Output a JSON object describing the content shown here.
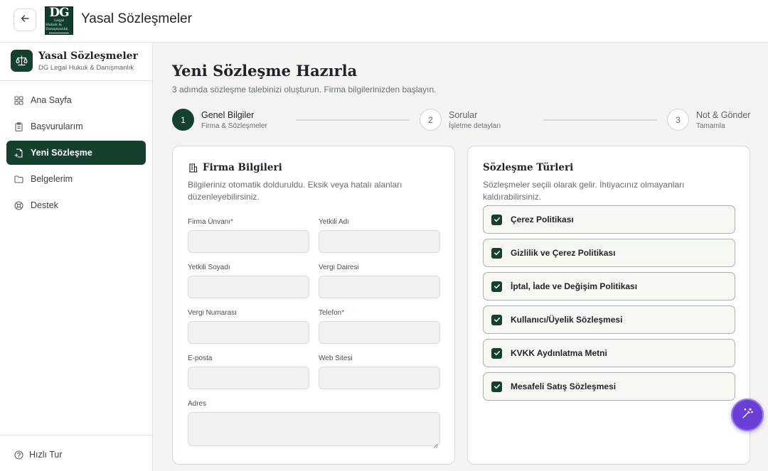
{
  "header": {
    "title": "Yasal Sözleşmeler",
    "back_icon": "arrow-left-icon",
    "logo": {
      "mark": "DG",
      "line": "Legal",
      "sub": "Hukuk & Danışmanlık"
    }
  },
  "sidebar": {
    "brand_name": "Yasal Sözleşmeler",
    "brand_sub": "DG Legal Hukuk & Danışmanlık",
    "brand_icon": "scale-icon",
    "items": [
      {
        "label": "Ana Sayfa",
        "icon": "grid-icon",
        "active": false
      },
      {
        "label": "Başvurularım",
        "icon": "clipboard-icon",
        "active": false
      },
      {
        "label": "Yeni Sözleşme",
        "icon": "file-plus-icon",
        "active": true
      },
      {
        "label": "Belgelerim",
        "icon": "folder-icon",
        "active": false
      },
      {
        "label": "Destek",
        "icon": "lifebuoy-icon",
        "active": false
      }
    ],
    "help_label": "Hızlı Tur",
    "help_icon": "question-circle-icon"
  },
  "page": {
    "title": "Yeni Sözleşme Hazırla",
    "subtitle": "3 adımda sözleşme talebinizi oluşturun. Firma bilgilerinizden başlayın."
  },
  "stepper": [
    {
      "number": "1",
      "label": "Genel Bilgiler",
      "sub": "Firma & Sözleşmeler",
      "state": "active"
    },
    {
      "number": "2",
      "label": "Sorular",
      "sub": "İşletme detayları",
      "state": "todo"
    },
    {
      "number": "3",
      "label": "Not & Gönder",
      "sub": "Tamamla",
      "state": "todo"
    }
  ],
  "firma": {
    "title": "Firma Bilgileri",
    "icon": "building-icon",
    "desc": "Bilgileriniz otomatik dolduruldu. Eksik veya hatalı alanları düzenleyebilirsiniz.",
    "fields": {
      "unvan": {
        "label": "Firma Ünvanı",
        "required": "*",
        "value": ""
      },
      "yetkili_adi": {
        "label": "Yetkili Adı",
        "value": ""
      },
      "yetkili_soyadi": {
        "label": "Yetkili Soyadı",
        "value": ""
      },
      "vergi_dairesi": {
        "label": "Vergi Dairesi",
        "value": ""
      },
      "vergi_no": {
        "label": "Vergi Numarası",
        "value": ""
      },
      "telefon": {
        "label": "Telefon",
        "required": "*",
        "value": ""
      },
      "eposta": {
        "label": "E-posta",
        "value": ""
      },
      "web": {
        "label": "Web Sitesi",
        "value": ""
      },
      "adres": {
        "label": "Adres",
        "value": ""
      }
    }
  },
  "contracts": {
    "title": "Sözleşme Türleri",
    "desc": "Sözleşmeler seçili olarak gelir. İhtiyacınız olmayanları kaldırabilirsiniz.",
    "items": [
      {
        "label": "Çerez Politikası",
        "checked": true
      },
      {
        "label": "Gizlilik ve Çerez Politikası",
        "checked": true
      },
      {
        "label": "İptal, İade ve Değişim Politikası",
        "checked": true
      },
      {
        "label": "Kullanıcı/Üyelik Sözleşmesi",
        "checked": true
      },
      {
        "label": "KVKK Aydınlatma Metni",
        "checked": true
      },
      {
        "label": "Mesafeli Satış Sözleşmesi",
        "checked": true
      }
    ]
  },
  "fab_icon": "magic-wand-icon",
  "colors": {
    "primary": "#15402d",
    "accent": "#6b3fd6",
    "required": "#c0392b"
  }
}
